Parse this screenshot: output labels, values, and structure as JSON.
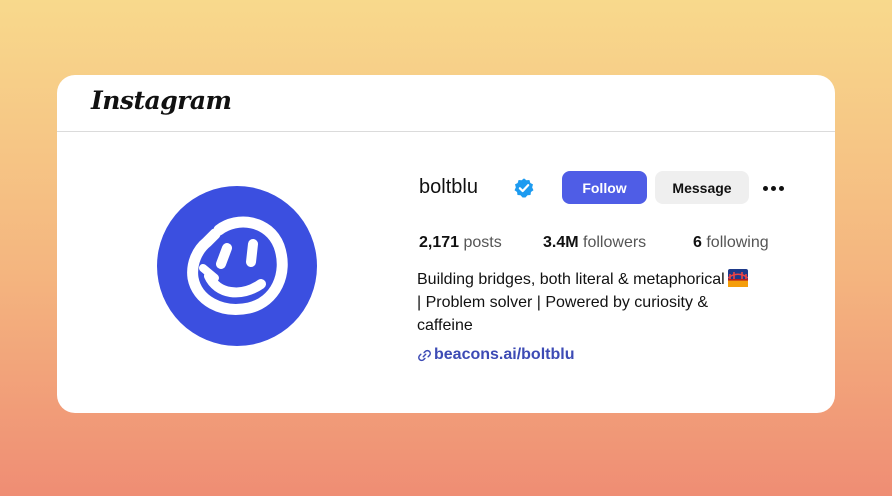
{
  "brand": {
    "name": "Instagram"
  },
  "profile": {
    "username": "boltblu",
    "verified": true,
    "avatar_color": "#3b4fe0",
    "avatar_icon": "smiley-face-icon"
  },
  "actions": {
    "follow_label": "Follow",
    "message_label": "Message",
    "more_icon": "more-options-icon"
  },
  "stats": {
    "posts": {
      "value": "2,171",
      "label": "posts"
    },
    "followers": {
      "value": "3.4M",
      "label": "followers"
    },
    "following": {
      "value": "6",
      "label": "following"
    }
  },
  "bio": {
    "line1": "Building bridges, both literal & metaphorical",
    "line2": "| Problem solver | Powered by curiosity &",
    "line3": "caffeine",
    "emoji_icon": "bridge-at-night-icon"
  },
  "link": {
    "text": "beacons.ai/boltblu",
    "icon": "link-icon"
  },
  "colors": {
    "accent": "#4f5de6",
    "link": "#3d4bb5",
    "verified": "#1d9bf0"
  }
}
